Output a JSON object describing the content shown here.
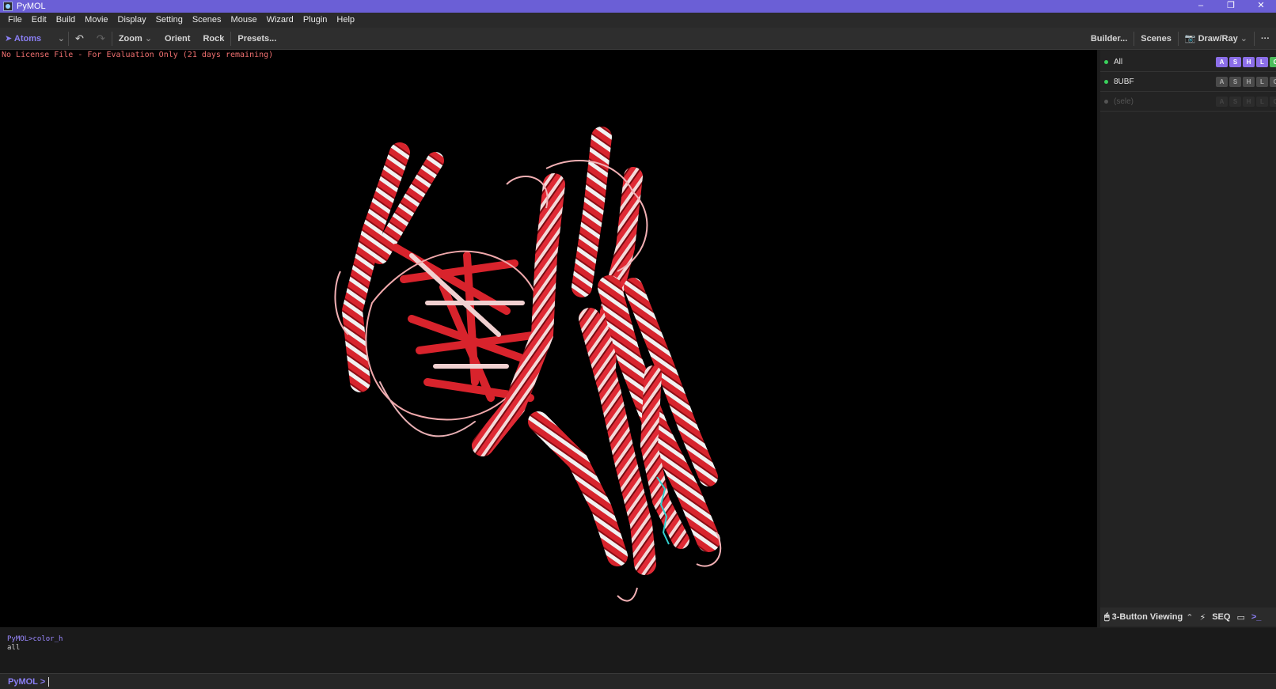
{
  "window": {
    "title": "PyMOL",
    "minimize": "–",
    "restore": "❐",
    "close": "✕"
  },
  "menu": [
    "File",
    "Edit",
    "Build",
    "Movie",
    "Display",
    "Setting",
    "Scenes",
    "Mouse",
    "Wizard",
    "Plugin",
    "Help"
  ],
  "toolbar": {
    "atoms_label": "Atoms",
    "zoom_label": "Zoom",
    "orient_label": "Orient",
    "rock_label": "Rock",
    "presets_label": "Presets...",
    "builder_label": "Builder...",
    "scenes_label": "Scenes",
    "drawray_label": "Draw/Ray",
    "more_label": "···"
  },
  "viewport": {
    "license_text": "No License File - For Evaluation Only (21 days remaining)",
    "colors": {
      "helix_red": "#e0252f",
      "helix_white": "#eeeeee",
      "ligand": "#33d0d0"
    }
  },
  "objects": [
    {
      "name": "All",
      "enabled": true,
      "buttons": [
        "A",
        "S",
        "H",
        "L",
        "C"
      ]
    },
    {
      "name": "8UBF",
      "enabled": true,
      "buttons": [
        "A",
        "S",
        "H",
        "L",
        "C"
      ]
    },
    {
      "name": "(sele)",
      "enabled": false,
      "buttons": [
        "A",
        "S",
        "H",
        "L",
        "C"
      ]
    }
  ],
  "viewbar": {
    "mode_label": "3-Button Viewing",
    "seq_label": "SEQ"
  },
  "console": {
    "line1": "PyMOL>color_h",
    "line2": "all"
  },
  "command": {
    "prompt": "PyMOL >"
  },
  "colors": {
    "accent": "#6b5fd6",
    "active_green": "#39d15c"
  }
}
